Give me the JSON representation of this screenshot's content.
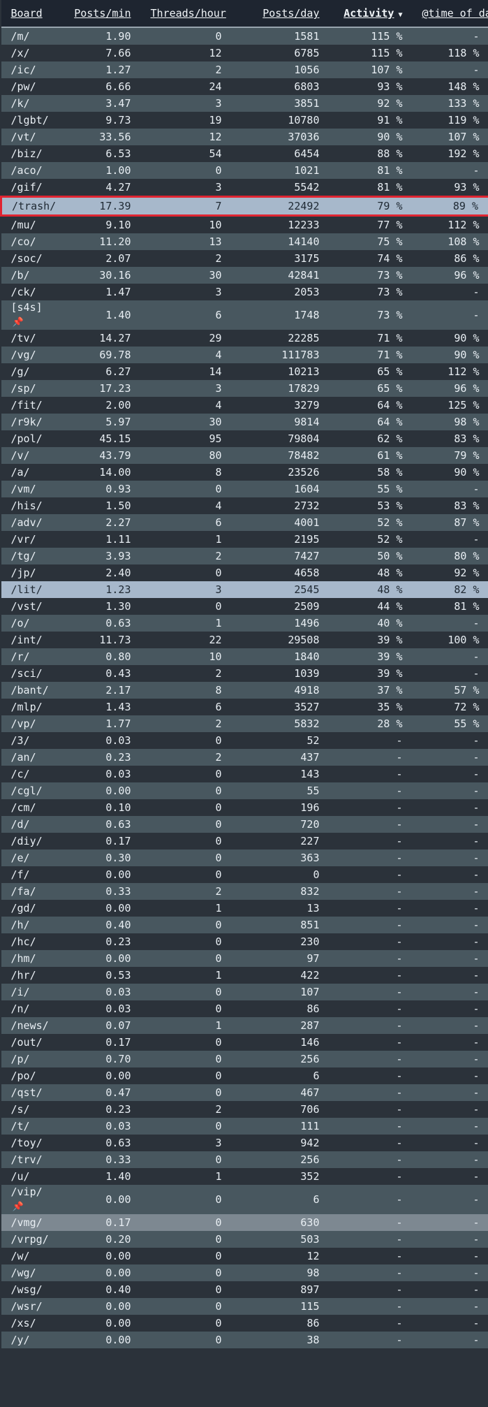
{
  "header": {
    "board": "Board",
    "posts_min": "Posts/min",
    "threads_hour": "Threads/hour",
    "posts_day": "Posts/day",
    "activity": "Activity",
    "time_of_day": "@time of day"
  },
  "icons": {
    "sort": "caret-down-icon",
    "pin": "pushpin-icon"
  },
  "colors": {
    "header_bg": "#1e2530",
    "row_odd": "#48575f",
    "row_even": "#2b323a",
    "highlight": "#a7b8cb",
    "selection_box": "#e02431"
  },
  "rows": [
    {
      "board": "/m/",
      "posts_min": "1.90",
      "threads_hour": "0",
      "posts_day": "1581",
      "activity": "115 %",
      "time_of_day": "-"
    },
    {
      "board": "/x/",
      "posts_min": "7.66",
      "threads_hour": "12",
      "posts_day": "6785",
      "activity": "115 %",
      "time_of_day": "118 %"
    },
    {
      "board": "/ic/",
      "posts_min": "1.27",
      "threads_hour": "2",
      "posts_day": "1056",
      "activity": "107 %",
      "time_of_day": "-"
    },
    {
      "board": "/pw/",
      "posts_min": "6.66",
      "threads_hour": "24",
      "posts_day": "6803",
      "activity": "93 %",
      "time_of_day": "148 %"
    },
    {
      "board": "/k/",
      "posts_min": "3.47",
      "threads_hour": "3",
      "posts_day": "3851",
      "activity": "92 %",
      "time_of_day": "133 %"
    },
    {
      "board": "/lgbt/",
      "posts_min": "9.73",
      "threads_hour": "19",
      "posts_day": "10780",
      "activity": "91 %",
      "time_of_day": "119 %"
    },
    {
      "board": "/vt/",
      "posts_min": "33.56",
      "threads_hour": "12",
      "posts_day": "37036",
      "activity": "90 %",
      "time_of_day": "107 %"
    },
    {
      "board": "/biz/",
      "posts_min": "6.53",
      "threads_hour": "54",
      "posts_day": "6454",
      "activity": "88 %",
      "time_of_day": "192 %"
    },
    {
      "board": "/aco/",
      "posts_min": "1.00",
      "threads_hour": "0",
      "posts_day": "1021",
      "activity": "81 %",
      "time_of_day": "-"
    },
    {
      "board": "/gif/",
      "posts_min": "4.27",
      "threads_hour": "3",
      "posts_day": "5542",
      "activity": "81 %",
      "time_of_day": "93 %"
    },
    {
      "board": "/trash/",
      "posts_min": "17.39",
      "threads_hour": "7",
      "posts_day": "22492",
      "activity": "79 %",
      "time_of_day": "89 %"
    },
    {
      "board": "/mu/",
      "posts_min": "9.10",
      "threads_hour": "10",
      "posts_day": "12233",
      "activity": "77 %",
      "time_of_day": "112 %"
    },
    {
      "board": "/co/",
      "posts_min": "11.20",
      "threads_hour": "13",
      "posts_day": "14140",
      "activity": "75 %",
      "time_of_day": "108 %"
    },
    {
      "board": "/soc/",
      "posts_min": "2.07",
      "threads_hour": "2",
      "posts_day": "3175",
      "activity": "74 %",
      "time_of_day": "86 %"
    },
    {
      "board": "/b/",
      "posts_min": "30.16",
      "threads_hour": "30",
      "posts_day": "42841",
      "activity": "73 %",
      "time_of_day": "96 %"
    },
    {
      "board": "/ck/",
      "posts_min": "1.47",
      "threads_hour": "3",
      "posts_day": "2053",
      "activity": "73 %",
      "time_of_day": "-"
    },
    {
      "board": "[s4s]",
      "posts_min": "1.40",
      "threads_hour": "6",
      "posts_day": "1748",
      "activity": "73 %",
      "time_of_day": "-"
    },
    {
      "board": "/tv/",
      "posts_min": "14.27",
      "threads_hour": "29",
      "posts_day": "22285",
      "activity": "71 %",
      "time_of_day": "90 %"
    },
    {
      "board": "/vg/",
      "posts_min": "69.78",
      "threads_hour": "4",
      "posts_day": "111783",
      "activity": "71 %",
      "time_of_day": "90 %"
    },
    {
      "board": "/g/",
      "posts_min": "6.27",
      "threads_hour": "14",
      "posts_day": "10213",
      "activity": "65 %",
      "time_of_day": "112 %"
    },
    {
      "board": "/sp/",
      "posts_min": "17.23",
      "threads_hour": "3",
      "posts_day": "17829",
      "activity": "65 %",
      "time_of_day": "96 %"
    },
    {
      "board": "/fit/",
      "posts_min": "2.00",
      "threads_hour": "4",
      "posts_day": "3279",
      "activity": "64 %",
      "time_of_day": "125 %"
    },
    {
      "board": "/r9k/",
      "posts_min": "5.97",
      "threads_hour": "30",
      "posts_day": "9814",
      "activity": "64 %",
      "time_of_day": "98 %"
    },
    {
      "board": "/pol/",
      "posts_min": "45.15",
      "threads_hour": "95",
      "posts_day": "79804",
      "activity": "62 %",
      "time_of_day": "83 %"
    },
    {
      "board": "/v/",
      "posts_min": "43.79",
      "threads_hour": "80",
      "posts_day": "78482",
      "activity": "61 %",
      "time_of_day": "79 %"
    },
    {
      "board": "/a/",
      "posts_min": "14.00",
      "threads_hour": "8",
      "posts_day": "23526",
      "activity": "58 %",
      "time_of_day": "90 %"
    },
    {
      "board": "/vm/",
      "posts_min": "0.93",
      "threads_hour": "0",
      "posts_day": "1604",
      "activity": "55 %",
      "time_of_day": "-"
    },
    {
      "board": "/his/",
      "posts_min": "1.50",
      "threads_hour": "4",
      "posts_day": "2732",
      "activity": "53 %",
      "time_of_day": "83 %"
    },
    {
      "board": "/adv/",
      "posts_min": "2.27",
      "threads_hour": "6",
      "posts_day": "4001",
      "activity": "52 %",
      "time_of_day": "87 %"
    },
    {
      "board": "/vr/",
      "posts_min": "1.11",
      "threads_hour": "1",
      "posts_day": "2195",
      "activity": "52 %",
      "time_of_day": "-"
    },
    {
      "board": "/tg/",
      "posts_min": "3.93",
      "threads_hour": "2",
      "posts_day": "7427",
      "activity": "50 %",
      "time_of_day": "80 %"
    },
    {
      "board": "/jp/",
      "posts_min": "2.40",
      "threads_hour": "0",
      "posts_day": "4658",
      "activity": "48 %",
      "time_of_day": "92 %"
    },
    {
      "board": "/lit/",
      "posts_min": "1.23",
      "threads_hour": "3",
      "posts_day": "2545",
      "activity": "48 %",
      "time_of_day": "82 %"
    },
    {
      "board": "/vst/",
      "posts_min": "1.30",
      "threads_hour": "0",
      "posts_day": "2509",
      "activity": "44 %",
      "time_of_day": "81 %"
    },
    {
      "board": "/o/",
      "posts_min": "0.63",
      "threads_hour": "1",
      "posts_day": "1496",
      "activity": "40 %",
      "time_of_day": "-"
    },
    {
      "board": "/int/",
      "posts_min": "11.73",
      "threads_hour": "22",
      "posts_day": "29508",
      "activity": "39 %",
      "time_of_day": "100 %"
    },
    {
      "board": "/r/",
      "posts_min": "0.80",
      "threads_hour": "10",
      "posts_day": "1840",
      "activity": "39 %",
      "time_of_day": "-"
    },
    {
      "board": "/sci/",
      "posts_min": "0.43",
      "threads_hour": "2",
      "posts_day": "1039",
      "activity": "39 %",
      "time_of_day": "-"
    },
    {
      "board": "/bant/",
      "posts_min": "2.17",
      "threads_hour": "8",
      "posts_day": "4918",
      "activity": "37 %",
      "time_of_day": "57 %"
    },
    {
      "board": "/mlp/",
      "posts_min": "1.43",
      "threads_hour": "6",
      "posts_day": "3527",
      "activity": "35 %",
      "time_of_day": "72 %"
    },
    {
      "board": "/vp/",
      "posts_min": "1.77",
      "threads_hour": "2",
      "posts_day": "5832",
      "activity": "28 %",
      "time_of_day": "55 %"
    },
    {
      "board": "/3/",
      "posts_min": "0.03",
      "threads_hour": "0",
      "posts_day": "52",
      "activity": "-",
      "time_of_day": "-"
    },
    {
      "board": "/an/",
      "posts_min": "0.23",
      "threads_hour": "2",
      "posts_day": "437",
      "activity": "-",
      "time_of_day": "-"
    },
    {
      "board": "/c/",
      "posts_min": "0.03",
      "threads_hour": "0",
      "posts_day": "143",
      "activity": "-",
      "time_of_day": "-"
    },
    {
      "board": "/cgl/",
      "posts_min": "0.00",
      "threads_hour": "0",
      "posts_day": "55",
      "activity": "-",
      "time_of_day": "-"
    },
    {
      "board": "/cm/",
      "posts_min": "0.10",
      "threads_hour": "0",
      "posts_day": "196",
      "activity": "-",
      "time_of_day": "-"
    },
    {
      "board": "/d/",
      "posts_min": "0.63",
      "threads_hour": "0",
      "posts_day": "720",
      "activity": "-",
      "time_of_day": "-"
    },
    {
      "board": "/diy/",
      "posts_min": "0.17",
      "threads_hour": "0",
      "posts_day": "227",
      "activity": "-",
      "time_of_day": "-"
    },
    {
      "board": "/e/",
      "posts_min": "0.30",
      "threads_hour": "0",
      "posts_day": "363",
      "activity": "-",
      "time_of_day": "-"
    },
    {
      "board": "/f/",
      "posts_min": "0.00",
      "threads_hour": "0",
      "posts_day": "0",
      "activity": "-",
      "time_of_day": "-"
    },
    {
      "board": "/fa/",
      "posts_min": "0.33",
      "threads_hour": "2",
      "posts_day": "832",
      "activity": "-",
      "time_of_day": "-"
    },
    {
      "board": "/gd/",
      "posts_min": "0.00",
      "threads_hour": "1",
      "posts_day": "13",
      "activity": "-",
      "time_of_day": "-"
    },
    {
      "board": "/h/",
      "posts_min": "0.40",
      "threads_hour": "0",
      "posts_day": "851",
      "activity": "-",
      "time_of_day": "-"
    },
    {
      "board": "/hc/",
      "posts_min": "0.23",
      "threads_hour": "0",
      "posts_day": "230",
      "activity": "-",
      "time_of_day": "-"
    },
    {
      "board": "/hm/",
      "posts_min": "0.00",
      "threads_hour": "0",
      "posts_day": "97",
      "activity": "-",
      "time_of_day": "-"
    },
    {
      "board": "/hr/",
      "posts_min": "0.53",
      "threads_hour": "1",
      "posts_day": "422",
      "activity": "-",
      "time_of_day": "-"
    },
    {
      "board": "/i/",
      "posts_min": "0.03",
      "threads_hour": "0",
      "posts_day": "107",
      "activity": "-",
      "time_of_day": "-"
    },
    {
      "board": "/n/",
      "posts_min": "0.03",
      "threads_hour": "0",
      "posts_day": "86",
      "activity": "-",
      "time_of_day": "-"
    },
    {
      "board": "/news/",
      "posts_min": "0.07",
      "threads_hour": "1",
      "posts_day": "287",
      "activity": "-",
      "time_of_day": "-"
    },
    {
      "board": "/out/",
      "posts_min": "0.17",
      "threads_hour": "0",
      "posts_day": "146",
      "activity": "-",
      "time_of_day": "-"
    },
    {
      "board": "/p/",
      "posts_min": "0.70",
      "threads_hour": "0",
      "posts_day": "256",
      "activity": "-",
      "time_of_day": "-"
    },
    {
      "board": "/po/",
      "posts_min": "0.00",
      "threads_hour": "0",
      "posts_day": "6",
      "activity": "-",
      "time_of_day": "-"
    },
    {
      "board": "/qst/",
      "posts_min": "0.47",
      "threads_hour": "0",
      "posts_day": "467",
      "activity": "-",
      "time_of_day": "-"
    },
    {
      "board": "/s/",
      "posts_min": "0.23",
      "threads_hour": "2",
      "posts_day": "706",
      "activity": "-",
      "time_of_day": "-"
    },
    {
      "board": "/t/",
      "posts_min": "0.03",
      "threads_hour": "0",
      "posts_day": "111",
      "activity": "-",
      "time_of_day": "-"
    },
    {
      "board": "/toy/",
      "posts_min": "0.63",
      "threads_hour": "3",
      "posts_day": "942",
      "activity": "-",
      "time_of_day": "-"
    },
    {
      "board": "/trv/",
      "posts_min": "0.33",
      "threads_hour": "0",
      "posts_day": "256",
      "activity": "-",
      "time_of_day": "-"
    },
    {
      "board": "/u/",
      "posts_min": "1.40",
      "threads_hour": "1",
      "posts_day": "352",
      "activity": "-",
      "time_of_day": "-"
    },
    {
      "board": "/vip/",
      "posts_min": "0.00",
      "threads_hour": "0",
      "posts_day": "6",
      "activity": "-",
      "time_of_day": "-"
    },
    {
      "board": "/vmg/",
      "posts_min": "0.17",
      "threads_hour": "0",
      "posts_day": "630",
      "activity": "-",
      "time_of_day": "-"
    },
    {
      "board": "/vrpg/",
      "posts_min": "0.20",
      "threads_hour": "0",
      "posts_day": "503",
      "activity": "-",
      "time_of_day": "-"
    },
    {
      "board": "/w/",
      "posts_min": "0.00",
      "threads_hour": "0",
      "posts_day": "12",
      "activity": "-",
      "time_of_day": "-"
    },
    {
      "board": "/wg/",
      "posts_min": "0.00",
      "threads_hour": "0",
      "posts_day": "98",
      "activity": "-",
      "time_of_day": "-"
    },
    {
      "board": "/wsg/",
      "posts_min": "0.40",
      "threads_hour": "0",
      "posts_day": "897",
      "activity": "-",
      "time_of_day": "-"
    },
    {
      "board": "/wsr/",
      "posts_min": "0.00",
      "threads_hour": "0",
      "posts_day": "115",
      "activity": "-",
      "time_of_day": "-"
    },
    {
      "board": "/xs/",
      "posts_min": "0.00",
      "threads_hour": "0",
      "posts_day": "86",
      "activity": "-",
      "time_of_day": "-"
    },
    {
      "board": "/y/",
      "posts_min": "0.00",
      "threads_hour": "0",
      "posts_day": "38",
      "activity": "-",
      "time_of_day": "-"
    }
  ]
}
